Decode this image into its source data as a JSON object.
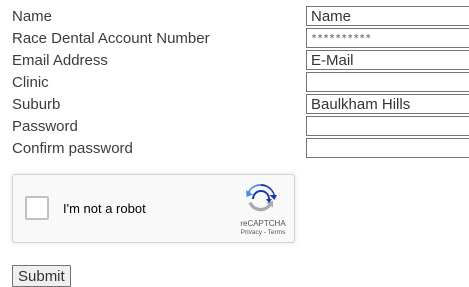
{
  "form": {
    "fields": [
      {
        "label": "Name",
        "value": "Name",
        "type": "text"
      },
      {
        "label": "Race Dental Account Number",
        "value": "**********",
        "type": "masked"
      },
      {
        "label": "Email Address",
        "value": "E-Mail",
        "type": "text"
      },
      {
        "label": "Clinic",
        "value": "",
        "type": "text"
      },
      {
        "label": "Suburb",
        "value": "Baulkham Hills",
        "type": "text"
      },
      {
        "label": "Password",
        "value": "",
        "type": "password"
      },
      {
        "label": "Confirm password",
        "value": "",
        "type": "password"
      }
    ],
    "submit_label": "Submit"
  },
  "recaptcha": {
    "checkbox_label": "I'm not a robot",
    "brand": "reCAPTCHA",
    "privacy_link": "Privacy",
    "separator": " - ",
    "terms_link": "Terms",
    "icon": "recaptcha-logo-icon",
    "colors": {
      "blue": "#1c3aa9",
      "light_blue": "#4a90e2",
      "gray": "#aaaaaa"
    }
  }
}
